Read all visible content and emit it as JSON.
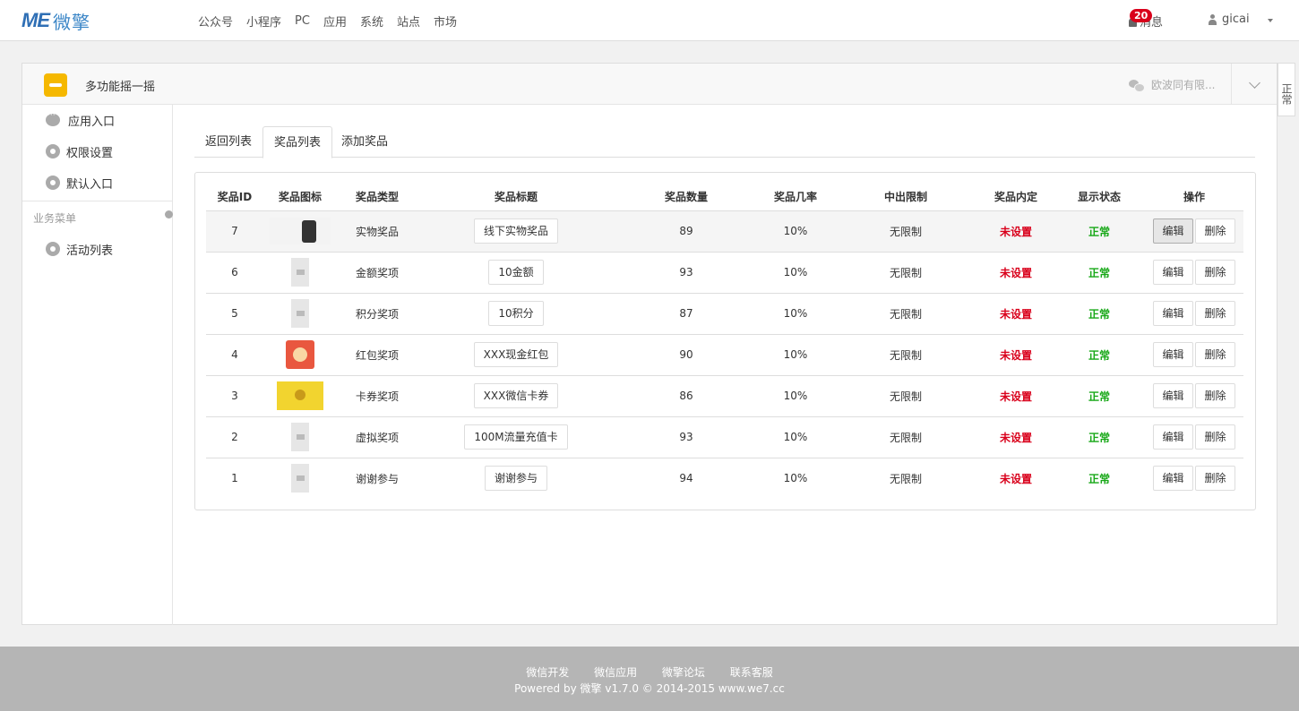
{
  "topnav": {
    "logo_mark": "ME",
    "logo_text": "微擎",
    "items": [
      "公众号",
      "小程序",
      "PC",
      "应用",
      "系统",
      "站点",
      "市场"
    ],
    "message_label": "消息",
    "message_count": "20",
    "username": "gicai"
  },
  "panel": {
    "app_title": "多功能摇一摇",
    "account_name": "欧波同有限...",
    "side_tab": "正常"
  },
  "sidebar": {
    "items": [
      "应用入口",
      "权限设置",
      "默认入口"
    ],
    "group_label": "业务菜单",
    "group_items": [
      "活动列表"
    ]
  },
  "tabs": [
    "返回列表",
    "奖品列表",
    "添加奖品"
  ],
  "table": {
    "headers": [
      "奖品ID",
      "奖品图标",
      "奖品类型",
      "奖品标题",
      "奖品数量",
      "奖品几率",
      "中出限制",
      "奖品内定",
      "显示状态",
      "操作"
    ],
    "rows": [
      {
        "id": "7",
        "icon": "phone-thumbnail",
        "type": "实物奖品",
        "title": "线下实物奖品",
        "qty": "89",
        "rate": "10%",
        "limit": "无限制",
        "preset": "未设置",
        "status": "正常"
      },
      {
        "id": "6",
        "icon": "placeholder-image",
        "type": "金额奖项",
        "title": "10金额",
        "qty": "93",
        "rate": "10%",
        "limit": "无限制",
        "preset": "未设置",
        "status": "正常"
      },
      {
        "id": "5",
        "icon": "placeholder-image",
        "type": "积分奖项",
        "title": "10积分",
        "qty": "87",
        "rate": "10%",
        "limit": "无限制",
        "preset": "未设置",
        "status": "正常"
      },
      {
        "id": "4",
        "icon": "red-packet-thumbnail",
        "type": "红包奖项",
        "title": "XXX现金红包",
        "qty": "90",
        "rate": "10%",
        "limit": "无限制",
        "preset": "未设置",
        "status": "正常"
      },
      {
        "id": "3",
        "icon": "card-thumbnail",
        "type": "卡券奖项",
        "title": "XXX微信卡券",
        "qty": "86",
        "rate": "10%",
        "limit": "无限制",
        "preset": "未设置",
        "status": "正常"
      },
      {
        "id": "2",
        "icon": "placeholder-image",
        "type": "虚拟奖项",
        "title": "100M流量充值卡",
        "qty": "93",
        "rate": "10%",
        "limit": "无限制",
        "preset": "未设置",
        "status": "正常"
      },
      {
        "id": "1",
        "icon": "placeholder-image",
        "type": "谢谢参与",
        "title": "谢谢参与",
        "qty": "94",
        "rate": "10%",
        "limit": "无限制",
        "preset": "未设置",
        "status": "正常"
      }
    ],
    "edit_label": "编辑",
    "delete_label": "删除"
  },
  "footer": {
    "links": [
      "微信开发",
      "微信应用",
      "微擎论坛",
      "联系客服"
    ],
    "copyright": "Powered by 微擎 v1.7.0 © 2014-2015 www.we7.cc"
  },
  "colors": {
    "brand": "#2f6fb5",
    "danger": "#d9001b",
    "success": "#17a817",
    "footer_bg": "#b5b5b5"
  }
}
